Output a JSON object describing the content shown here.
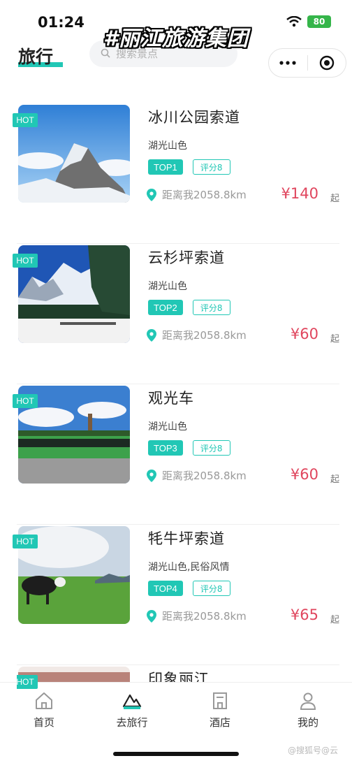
{
  "status": {
    "time": "01:24",
    "battery": "80"
  },
  "overlay_caption": "#丽江旅游集团",
  "header": {
    "title": "旅行",
    "search_placeholder": "搜索景点"
  },
  "items": [
    {
      "hot": "HOT",
      "name": "冰川公园索道",
      "tags": "湖光山色",
      "rank": "TOP1",
      "score": "评分8",
      "distance": "距离我2058.8km",
      "price": "¥140",
      "price_suffix": "起"
    },
    {
      "hot": "HOT",
      "name": "云杉坪索道",
      "tags": "湖光山色",
      "rank": "TOP2",
      "score": "评分8",
      "distance": "距离我2058.8km",
      "price": "¥60",
      "price_suffix": "起"
    },
    {
      "hot": "HOT",
      "name": "观光车",
      "tags": "湖光山色",
      "rank": "TOP3",
      "score": "评分8",
      "distance": "距离我2058.8km",
      "price": "¥60",
      "price_suffix": "起"
    },
    {
      "hot": "HOT",
      "name": "牦牛坪索道",
      "tags": "湖光山色,民俗风情",
      "rank": "TOP4",
      "score": "评分8",
      "distance": "距离我2058.8km",
      "price": "¥65",
      "price_suffix": "起"
    }
  ],
  "peek_item": {
    "hot": "HOT",
    "name": "印象丽江"
  },
  "tabbar": [
    {
      "label": "首页",
      "icon": "home-icon"
    },
    {
      "label": "去旅行",
      "icon": "mountain-icon"
    },
    {
      "label": "酒店",
      "icon": "hotel-icon"
    },
    {
      "label": "我的",
      "icon": "user-icon"
    }
  ],
  "watermark": "@搜狐号@云",
  "colors": {
    "accent": "#21c7b5",
    "price": "#e0465e"
  }
}
